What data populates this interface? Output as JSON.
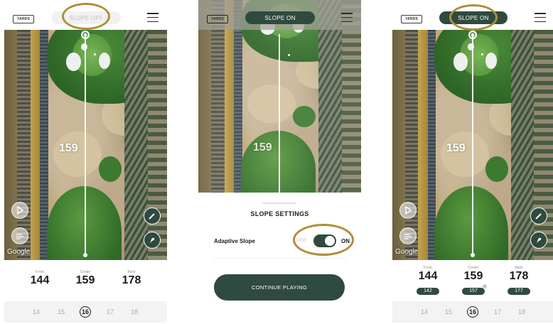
{
  "screens": [
    {
      "yards_label": "YARDS",
      "slope_label": "SLOPE OFF",
      "map_distance": "159",
      "map_credit": "Google",
      "distances": [
        {
          "label": "Front",
          "value": "144"
        },
        {
          "label": "Center",
          "value": "159"
        },
        {
          "label": "Back",
          "value": "178"
        }
      ],
      "holes": [
        "14",
        "15",
        "16",
        "17",
        "18"
      ],
      "active_hole": "16"
    },
    {
      "yards_label": "YARDS",
      "slope_label": "SLOPE ON",
      "map_distance": "159",
      "settings": {
        "title": "SLOPE SETTINGS",
        "row_label": "Adaptive Slope",
        "off_label": "OFF",
        "on_label": "ON",
        "adaptive_slope_on": true,
        "continue_label": "CONTINUE PLAYING"
      }
    },
    {
      "yards_label": "YARDS",
      "slope_label": "SLOPE ON",
      "map_distance": "159",
      "map_credit": "Google",
      "distances": [
        {
          "label": "Front",
          "value": "144",
          "slope_value": "142"
        },
        {
          "label": "Center",
          "value": "159",
          "slope_value": "157"
        },
        {
          "label": "Back",
          "value": "178",
          "slope_value": "177"
        }
      ],
      "holes": [
        "14",
        "15",
        "16",
        "17",
        "18"
      ],
      "active_hole": "16"
    }
  ],
  "colors": {
    "brand_green": "#2f4a3f",
    "highlight_ring": "#b08d3b",
    "slope_off_text": "#c0c0c0"
  },
  "icons": [
    "hamburger-menu-icon",
    "navigate-arrow-icon",
    "wind-icon",
    "pencil-icon",
    "wedge-club-icon"
  ]
}
